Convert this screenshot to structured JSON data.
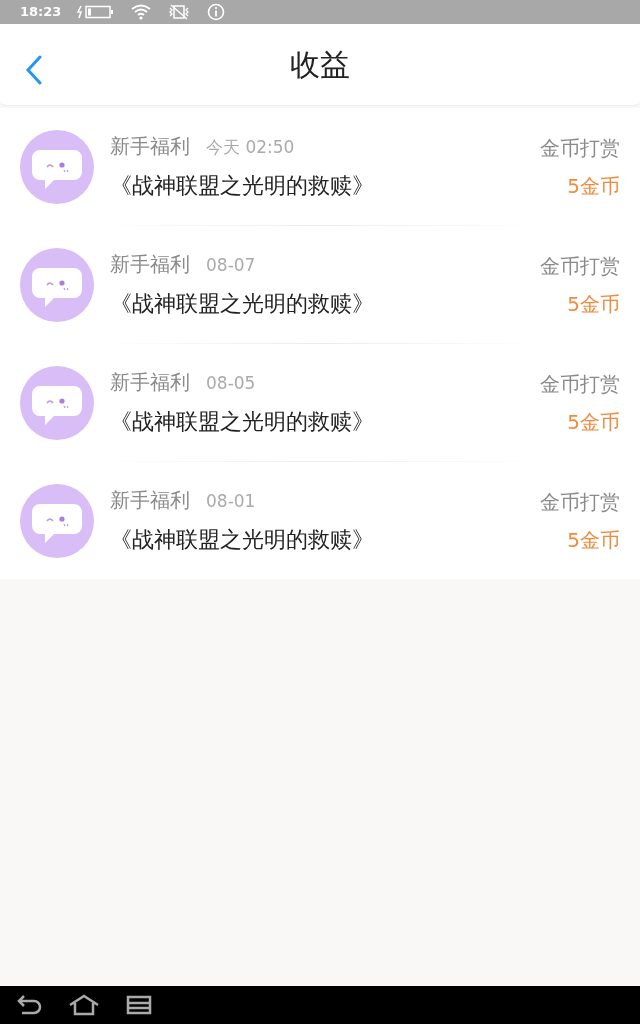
{
  "status_bar": {
    "time": "18:23"
  },
  "header": {
    "title": "收益"
  },
  "items": [
    {
      "category": "新手福利",
      "date": "今天 02:50",
      "title": "《战神联盟之光明的救赎》",
      "type": "金币打赏",
      "amount": "5金币"
    },
    {
      "category": "新手福利",
      "date": "08-07",
      "title": "《战神联盟之光明的救赎》",
      "type": "金币打赏",
      "amount": "5金币"
    },
    {
      "category": "新手福利",
      "date": "08-05",
      "title": "《战神联盟之光明的救赎》",
      "type": "金币打赏",
      "amount": "5金币"
    },
    {
      "category": "新手福利",
      "date": "08-01",
      "title": "《战神联盟之光明的救赎》",
      "type": "金币打赏",
      "amount": "5金币"
    }
  ]
}
